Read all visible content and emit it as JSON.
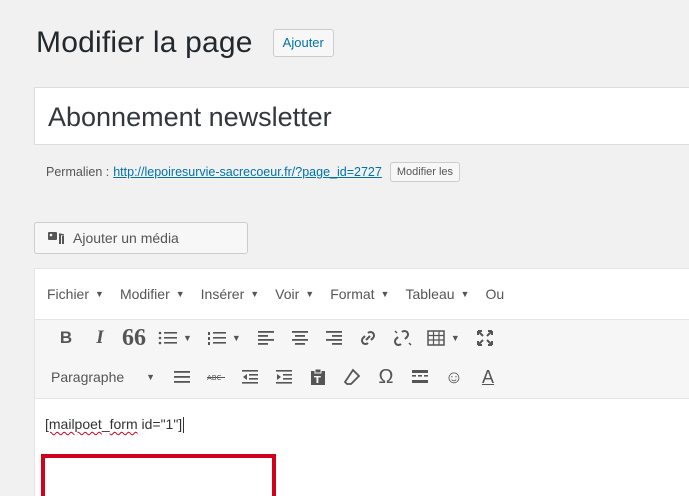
{
  "header": {
    "title": "Modifier la page",
    "add_label": "Ajouter"
  },
  "post": {
    "title": "Abonnement newsletter"
  },
  "permalink": {
    "label": "Permalien :",
    "url": "http://lepoiresurvie-sacrecoeur.fr/?page_id=2727",
    "edit_label": "Modifier les"
  },
  "media": {
    "add_label": "Ajouter un média",
    "icon": "media-icon"
  },
  "editor": {
    "menubar": [
      "Fichier",
      "Modifier",
      "Insérer",
      "Voir",
      "Format",
      "Tableau",
      "Ou"
    ],
    "toolbar1": [
      "bold",
      "italic",
      "blockquote",
      "bullet-list",
      "numbered-list",
      "align-left",
      "align-center",
      "align-right",
      "link",
      "unlink",
      "table",
      "fullscreen"
    ],
    "toolbar2": [
      "paragraph-select",
      "horizontal-rule",
      "strikethrough",
      "outdent",
      "indent",
      "paste-text",
      "clear-format",
      "special-char",
      "more-tag",
      "emoticons",
      "text-color"
    ],
    "bold_glyph": "B",
    "italic_glyph": "I",
    "quote_glyph": "66",
    "omega_glyph": "Ω",
    "smile_glyph": "☺",
    "textcolor_glyph": "A",
    "paragraph_label": "Paragraphe",
    "content": {
      "shortcode_word1": "[mailpoet",
      "shortcode_sep": "_",
      "shortcode_word2": "form",
      "shortcode_rest": " id=\"1\"]"
    }
  },
  "colors": {
    "accent": "#0073aa",
    "highlight_border": "#d0021b"
  }
}
